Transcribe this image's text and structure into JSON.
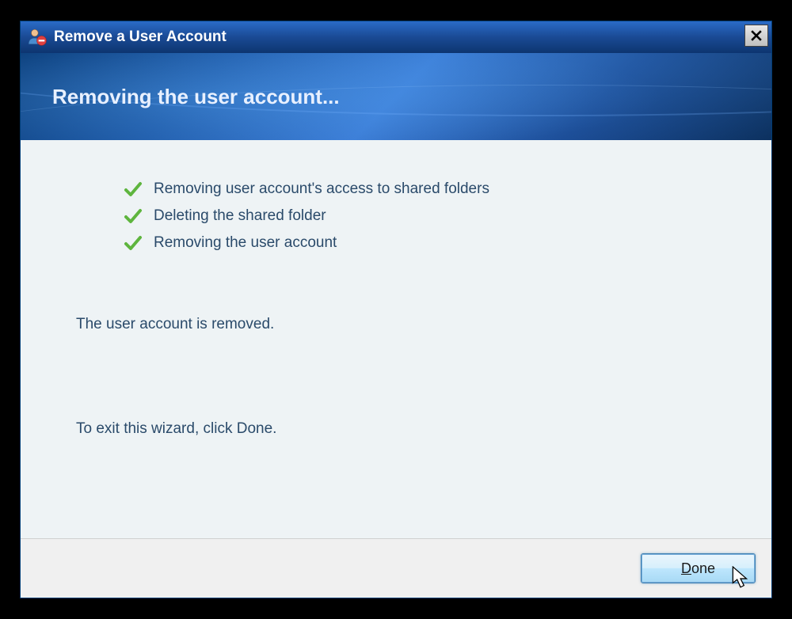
{
  "window": {
    "title": "Remove a User Account",
    "icon": "user-remove-icon"
  },
  "banner": {
    "title": "Removing the user account..."
  },
  "tasks": [
    {
      "label": "Removing user account's access to shared folders",
      "status": "complete"
    },
    {
      "label": "Deleting the shared folder",
      "status": "complete"
    },
    {
      "label": "Removing the user account",
      "status": "complete"
    }
  ],
  "status_message": "The user account is removed.",
  "exit_hint": "To exit this wizard, click Done.",
  "buttons": {
    "done": "Done"
  },
  "colors": {
    "titlebar_gradient_start": "#2a6bc7",
    "titlebar_gradient_end": "#0d3570",
    "banner_primary": "#1e5aa8",
    "content_bg": "#eef3f5",
    "text": "#2a4a6a",
    "check": "#5eb53e",
    "done_button_border": "#3c7fb1"
  }
}
